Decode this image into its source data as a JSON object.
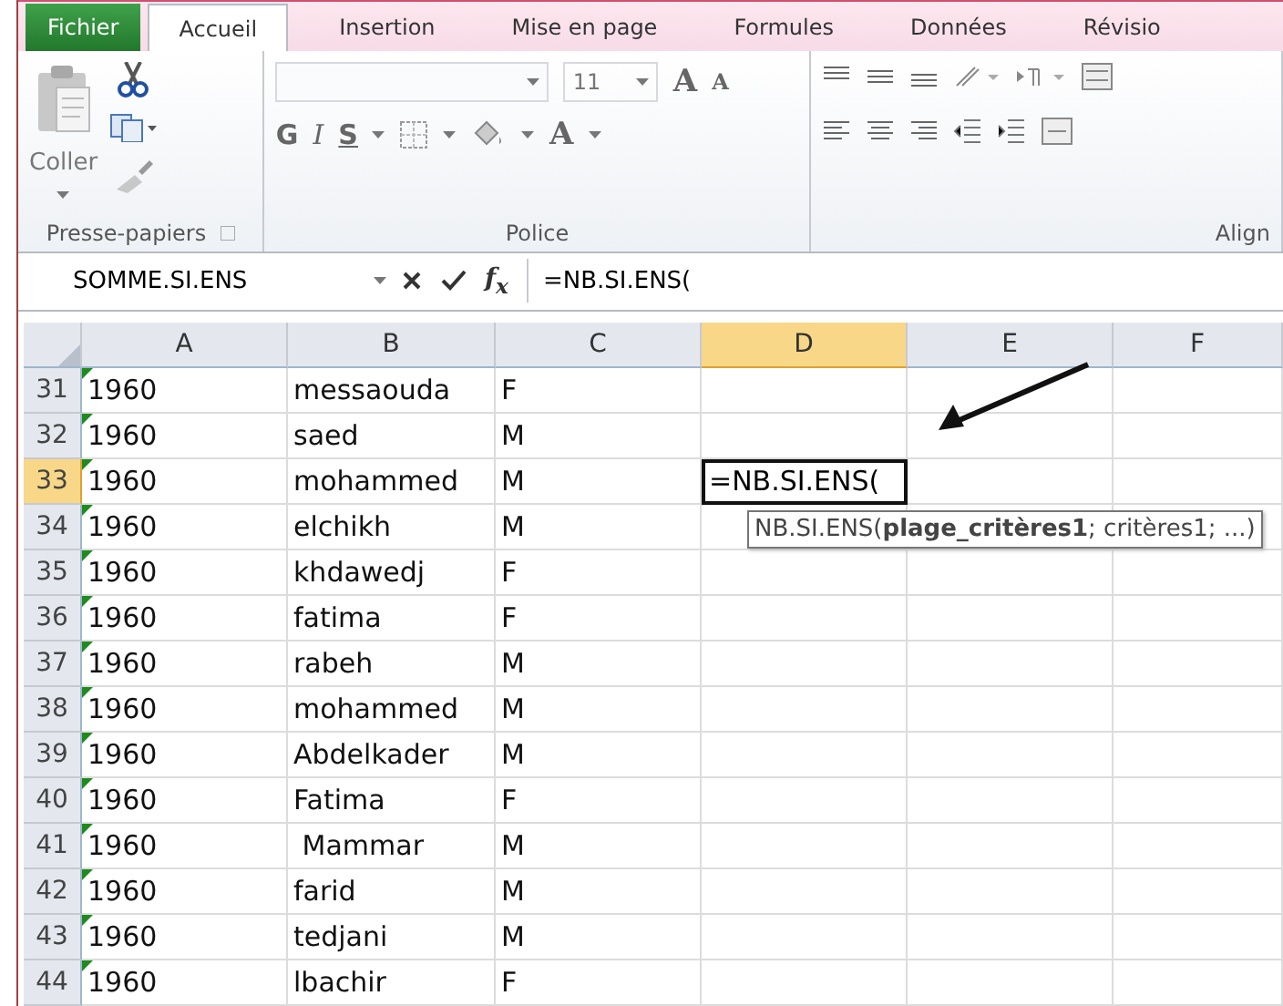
{
  "ribbon_tabs": [
    {
      "label": "Fichier",
      "kind": "file",
      "selected": false
    },
    {
      "label": "Accueil",
      "kind": "tab",
      "selected": true
    },
    {
      "label": "Insertion",
      "kind": "tab",
      "selected": false
    },
    {
      "label": "Mise en page",
      "kind": "tab",
      "selected": false
    },
    {
      "label": "Formules",
      "kind": "tab",
      "selected": false
    },
    {
      "label": "Données",
      "kind": "tab",
      "selected": false
    },
    {
      "label": "Révisio",
      "kind": "tab",
      "selected": false
    }
  ],
  "clipboard": {
    "paste_label": "Coller",
    "group_label": "Presse-papiers"
  },
  "font": {
    "size": "11",
    "grow": "A",
    "shrink": "A",
    "bold": "G",
    "italic": "I",
    "underline": "S",
    "font_color": "A",
    "group_label": "Police"
  },
  "alignment": {
    "group_label": "Align"
  },
  "formula_bar": {
    "name_box": "SOMME.SI.ENS",
    "fx": "f$_{x}$",
    "formula": "=NB.SI.ENS("
  },
  "columns": [
    {
      "label": "A",
      "selected": false
    },
    {
      "label": "B",
      "selected": false
    },
    {
      "label": "C",
      "selected": false
    },
    {
      "label": "D",
      "selected": true
    },
    {
      "label": "E",
      "selected": false
    },
    {
      "label": "F",
      "selected": false
    }
  ],
  "rows": [
    {
      "number": "31",
      "selected": false,
      "flagged": true,
      "cells": [
        "1960",
        "messaouda",
        "F"
      ]
    },
    {
      "number": "32",
      "selected": false,
      "flagged": true,
      "cells": [
        "1960",
        "saed",
        "M"
      ]
    },
    {
      "number": "33",
      "selected": true,
      "flagged": true,
      "editing": true,
      "cells": [
        "1960",
        "mohammed",
        "M",
        "=NB.SI.ENS("
      ]
    },
    {
      "number": "34",
      "selected": false,
      "flagged": true,
      "cells": [
        "1960",
        "elchikh",
        "M"
      ]
    },
    {
      "number": "35",
      "selected": false,
      "flagged": true,
      "cells": [
        "1960",
        "khdawedj",
        "F"
      ]
    },
    {
      "number": "36",
      "selected": false,
      "flagged": true,
      "cells": [
        "1960",
        "fatima",
        "F"
      ]
    },
    {
      "number": "37",
      "selected": false,
      "flagged": true,
      "cells": [
        "1960",
        "rabeh",
        "M"
      ]
    },
    {
      "number": "38",
      "selected": false,
      "flagged": true,
      "cells": [
        "1960",
        "mohammed",
        "M"
      ]
    },
    {
      "number": "39",
      "selected": false,
      "flagged": true,
      "cells": [
        "1960",
        "Abdelkader",
        "M"
      ]
    },
    {
      "number": "40",
      "selected": false,
      "flagged": true,
      "cells": [
        "1960",
        "Fatima",
        "F"
      ]
    },
    {
      "number": "41",
      "selected": false,
      "flagged": true,
      "cells": [
        "1960",
        " Mammar",
        "M"
      ]
    },
    {
      "number": "42",
      "selected": false,
      "flagged": true,
      "cells": [
        "1960",
        "farid",
        "M"
      ]
    },
    {
      "number": "43",
      "selected": false,
      "flagged": true,
      "cells": [
        "1960",
        "tedjani",
        "M"
      ]
    },
    {
      "number": "44",
      "selected": false,
      "flagged": true,
      "cells": [
        "1960",
        "lbachir",
        "F"
      ]
    }
  ],
  "tooltip": "NB.SI.ENS(**plage_critères1**; critères1; ...)"
}
